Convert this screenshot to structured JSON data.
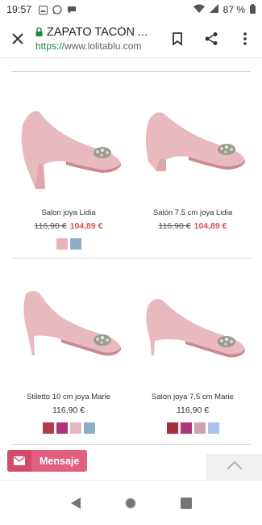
{
  "status": {
    "time": "19:57",
    "battery": "87 %"
  },
  "toolbar": {
    "title": "ZAPATO TACÓN ...",
    "url_scheme": "https://",
    "url_host": "www.lolitablu.com"
  },
  "products": [
    {
      "name": "Salon joya Lidia",
      "price_old": "116,90 €",
      "price_new": "104,89 €",
      "swatches": [
        "#e9b5bd",
        "#8fadc9"
      ]
    },
    {
      "name": "Salón 7.5 cm joya Lidia",
      "price_old": "116,90 €",
      "price_new": "104,89 €",
      "swatches": []
    },
    {
      "name": "Stiletto 10 cm joya Marie",
      "price": "116,90 €",
      "swatches": [
        "#b33a4a",
        "#b0347a",
        "#e7b9c2",
        "#8fadc9"
      ]
    },
    {
      "name": "Salón joya 7,5 cm Marie",
      "price": "116,90 €",
      "swatches": [
        "#a4303c",
        "#b0347a",
        "#cfa3aa",
        "#a9c1ee"
      ]
    }
  ],
  "message_button": {
    "label": "Mensaje"
  },
  "colors": {
    "shoe_pink": "#e8b9bf",
    "accent_pink": "#e0607d",
    "sale_red": "#d9534f"
  }
}
